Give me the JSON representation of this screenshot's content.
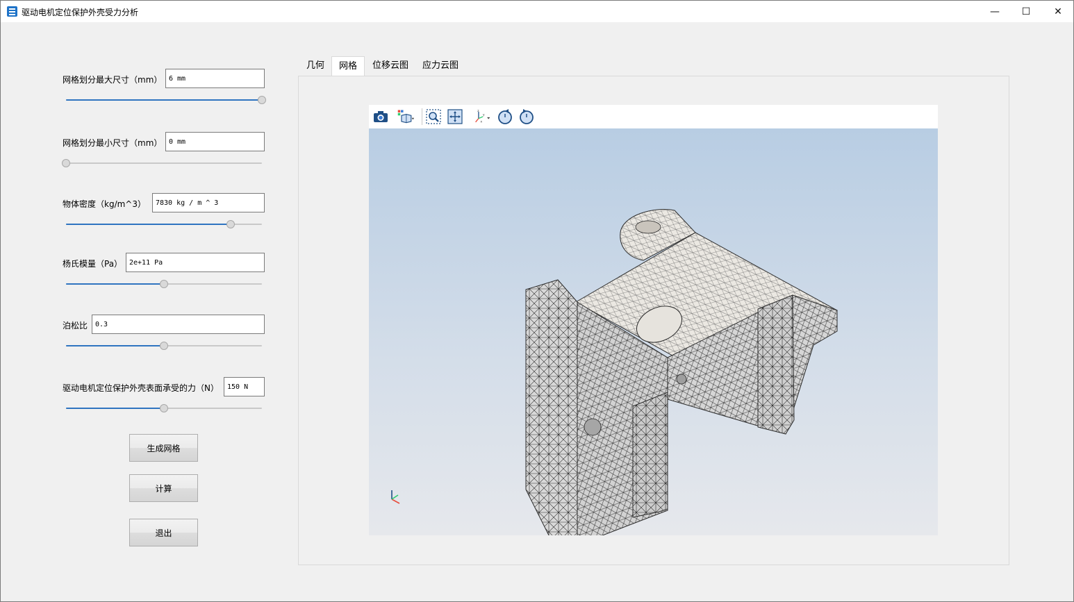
{
  "window": {
    "title": "驱动电机定位保护外壳受力分析",
    "minimize": "—",
    "maximize": "☐",
    "close": "✕"
  },
  "params": [
    {
      "label": "网格划分最大尺寸（mm）",
      "value": "6 mm",
      "slider": 1.0
    },
    {
      "label": "网格划分最小尺寸（mm）",
      "value": "0 mm",
      "slider": 0.0
    },
    {
      "label": "物体密度（kg/m^3）",
      "value": "7830 kg / m ^ 3",
      "slider": 0.84
    },
    {
      "label": "杨氏模量（Pa）",
      "value": "2e+11 Pa",
      "slider": 0.5
    },
    {
      "label": "泊松比",
      "value": "0.3",
      "slider": 0.5
    },
    {
      "label": "驱动电机定位保护外壳表面承受的力（N）",
      "value": "150 N",
      "slider": 0.5
    }
  ],
  "buttons": {
    "mesh": "生成网格",
    "compute": "计算",
    "exit": "退出"
  },
  "tabs": [
    "几何",
    "网格",
    "位移云图",
    "应力云图"
  ],
  "active_tab": "网格",
  "toolbar_icons": [
    "camera-icon",
    "view-cube-icon",
    "zoom-box-icon",
    "fit-all-icon",
    "axis-orientation-icon",
    "rotate-left-icon",
    "rotate-right-icon"
  ],
  "colors": {
    "slider_fill": "#2f74c0",
    "viewport_top": "#b8cde3",
    "viewport_bottom": "#e6e8ec",
    "mesh_line": "#2b2b2b"
  }
}
